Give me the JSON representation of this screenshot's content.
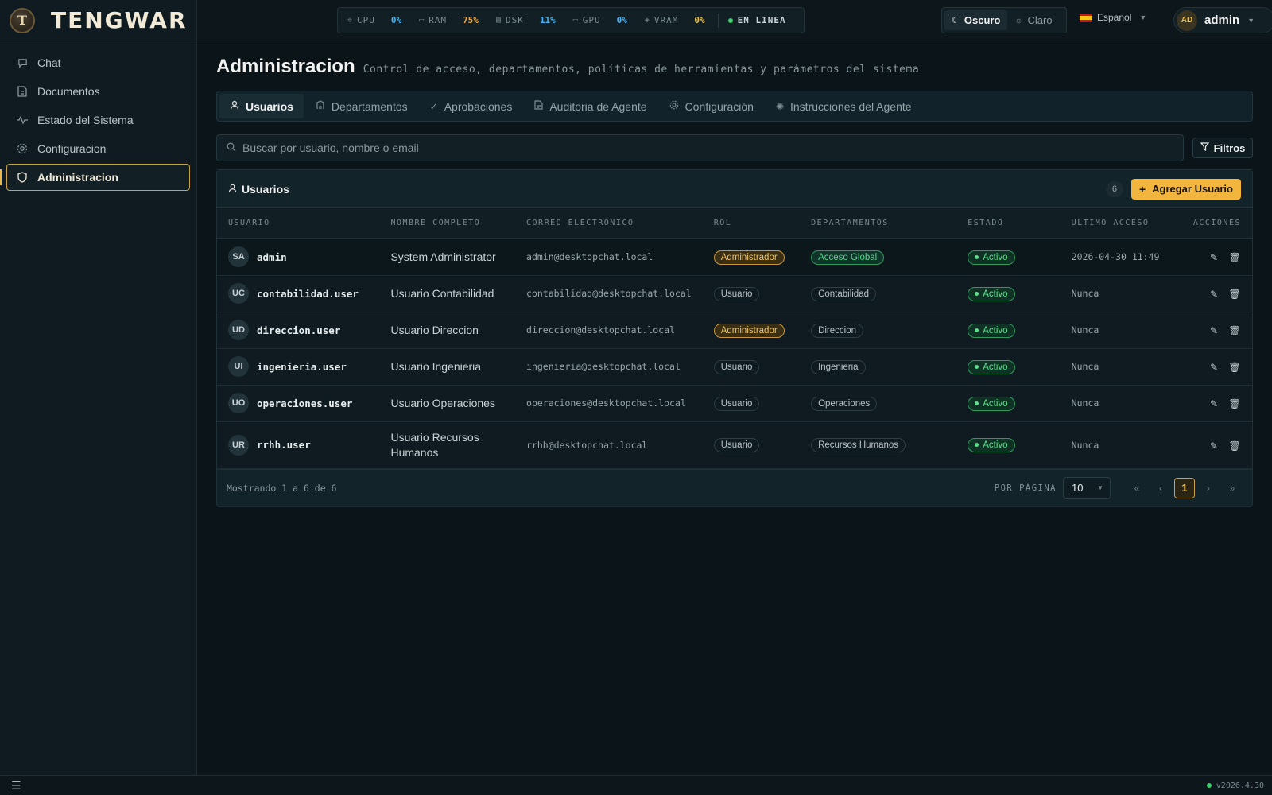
{
  "app": {
    "brand": "TENGWAR",
    "logo_letter": "T"
  },
  "sidebar": {
    "items": [
      {
        "label": "Chat",
        "icon": "chat-icon"
      },
      {
        "label": "Documentos",
        "icon": "document-icon"
      },
      {
        "label": "Estado del Sistema",
        "icon": "activity-icon"
      },
      {
        "label": "Configuracion",
        "icon": "gear-icon"
      },
      {
        "label": "Administracion",
        "icon": "shield-icon",
        "active": true
      }
    ]
  },
  "topbar": {
    "stats": [
      {
        "label": "CPU",
        "value": "0%",
        "color": "#4db3f0"
      },
      {
        "label": "RAM",
        "value": "75%",
        "color": "#f0a940"
      },
      {
        "label": "DSK",
        "value": "11%",
        "color": "#4db3f0"
      },
      {
        "label": "GPU",
        "value": "0%",
        "color": "#4db3f0"
      },
      {
        "label": "VRAM",
        "value": "0%",
        "color": "#e8c350"
      }
    ],
    "status": "EN LINEA",
    "theme": {
      "dark": "Oscuro",
      "light": "Claro",
      "selected": "dark"
    },
    "language": "Espanol",
    "user": {
      "initials": "AD",
      "name": "admin"
    }
  },
  "page": {
    "title": "Administracion",
    "subtitle": "Control de acceso, departamentos, políticas de herramientas y parámetros del sistema"
  },
  "tabs": [
    {
      "label": "Usuarios",
      "icon": "user-icon",
      "active": true
    },
    {
      "label": "Departamentos",
      "icon": "building-icon"
    },
    {
      "label": "Aprobaciones",
      "icon": "check-icon"
    },
    {
      "label": "Auditoria de Agente",
      "icon": "audit-icon"
    },
    {
      "label": "Configuración",
      "icon": "gear-icon"
    },
    {
      "label": "Instrucciones del Agente",
      "icon": "loader-icon"
    }
  ],
  "search": {
    "placeholder": "Buscar por usuario, nombre o email",
    "filters_label": "Filtros"
  },
  "users_card": {
    "title": "Usuarios",
    "count": "6",
    "add_label": "Agregar Usuario",
    "columns": [
      "USUARIO",
      "NOMBRE COMPLETO",
      "CORREO ELECTRONICO",
      "ROL",
      "DEPARTAMENTOS",
      "ESTADO",
      "ULTIMO ACCESO",
      "ACCIONES"
    ],
    "rows": [
      {
        "initials": "SA",
        "username": "admin",
        "full_name": "System Administrator",
        "email": "admin@desktopchat.local",
        "role": "Administrador",
        "department": "Acceso Global",
        "status": "Activo",
        "last_access": "2026-04-30 11:49"
      },
      {
        "initials": "UC",
        "username": "contabilidad.user",
        "full_name": "Usuario Contabilidad",
        "email": "contabilidad@desktopchat.local",
        "role": "Usuario",
        "department": "Contabilidad",
        "status": "Activo",
        "last_access": "Nunca"
      },
      {
        "initials": "UD",
        "username": "direccion.user",
        "full_name": "Usuario Direccion",
        "email": "direccion@desktopchat.local",
        "role": "Administrador",
        "department": "Direccion",
        "status": "Activo",
        "last_access": "Nunca"
      },
      {
        "initials": "UI",
        "username": "ingenieria.user",
        "full_name": "Usuario Ingenieria",
        "email": "ingenieria@desktopchat.local",
        "role": "Usuario",
        "department": "Ingenieria",
        "status": "Activo",
        "last_access": "Nunca"
      },
      {
        "initials": "UO",
        "username": "operaciones.user",
        "full_name": "Usuario Operaciones",
        "email": "operaciones@desktopchat.local",
        "role": "Usuario",
        "department": "Operaciones",
        "status": "Activo",
        "last_access": "Nunca"
      },
      {
        "initials": "UR",
        "username": "rrhh.user",
        "full_name": "Usuario Recursos Humanos",
        "email": "rrhh@desktopchat.local",
        "role": "Usuario",
        "department": "Recursos Humanos",
        "status": "Activo",
        "last_access": "Nunca"
      }
    ],
    "footer": {
      "showing": "Mostrando 1 a 6 de 6",
      "per_page_label": "POR PÁGINA",
      "per_page": "10",
      "current_page": "1"
    }
  },
  "footer": {
    "version": "v2026.4.30"
  }
}
